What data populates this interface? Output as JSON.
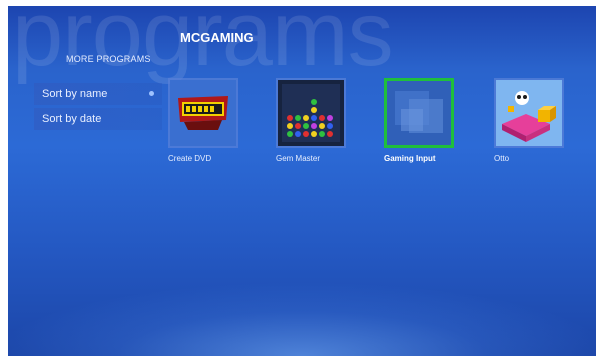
{
  "watermark": "programs",
  "header": {
    "title": "MCGAMING"
  },
  "sidebar": {
    "heading": "MORE PROGRAMS",
    "items": [
      {
        "label": "Sort by name"
      },
      {
        "label": "Sort by date"
      }
    ]
  },
  "programs": [
    {
      "label": "Create DVD",
      "icon": "primetime-logo-icon"
    },
    {
      "label": "Gem Master",
      "icon": "gem-grid-icon"
    },
    {
      "label": "Gaming Input",
      "icon": "generic-app-icon",
      "selected": true
    },
    {
      "label": "Otto",
      "icon": "otto-game-icon"
    }
  ],
  "colors": {
    "background": "#2a63cc",
    "selection_border": "#1fbf3c",
    "text": "#ffffff"
  }
}
